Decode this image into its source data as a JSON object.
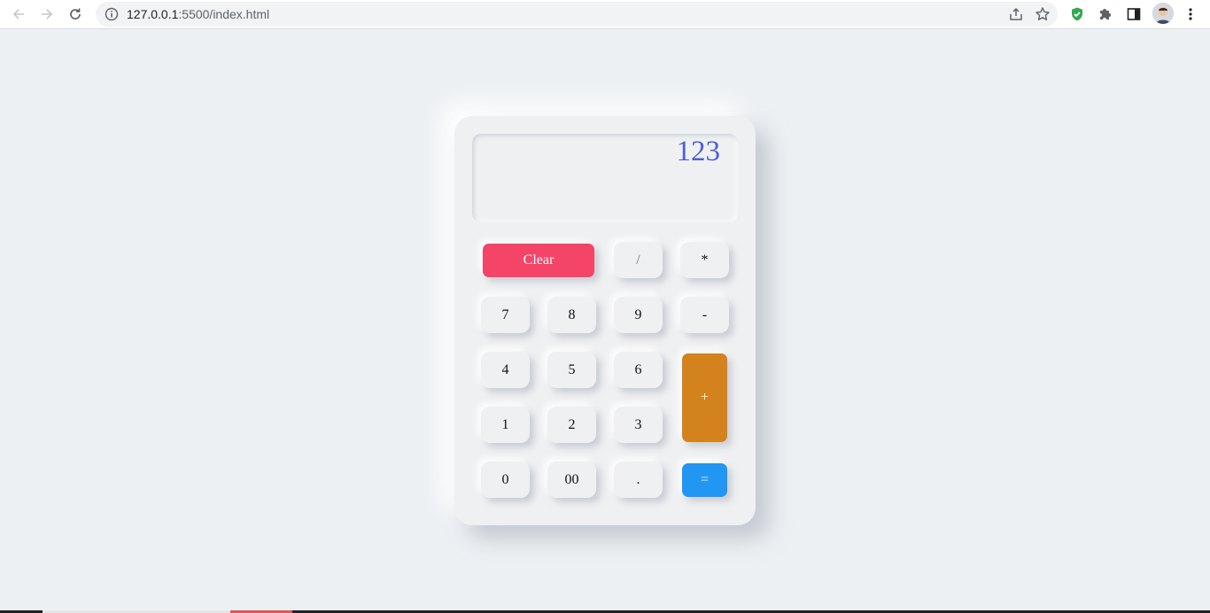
{
  "browser": {
    "url_host": "127.0.0.1",
    "url_rest": ":5500/index.html",
    "accent": "#1a73e8"
  },
  "icons": {
    "back": "arrow-left-icon",
    "forward": "arrow-right-icon",
    "reload": "reload-icon",
    "info": "info-icon",
    "share": "share-icon",
    "bookmark": "star-icon",
    "extension_shield": "shield-check-icon",
    "extensions": "puzzle-icon",
    "side_panel": "side-panel-icon",
    "menu": "more-vert-icon"
  },
  "calculator": {
    "display": "123",
    "colors": {
      "clear": "#f44468",
      "plus": "#d4821d",
      "equals": "#2196f3",
      "display_text": "#4d5fd6"
    },
    "keys": {
      "clear": "Clear",
      "divide": "/",
      "multiply": "*",
      "seven": "7",
      "eight": "8",
      "nine": "9",
      "minus": "-",
      "four": "4",
      "five": "5",
      "six": "6",
      "plus": "+",
      "one": "1",
      "two": "2",
      "three": "3",
      "zero": "0",
      "double_zero": "00",
      "dot": ".",
      "equals": "="
    }
  }
}
